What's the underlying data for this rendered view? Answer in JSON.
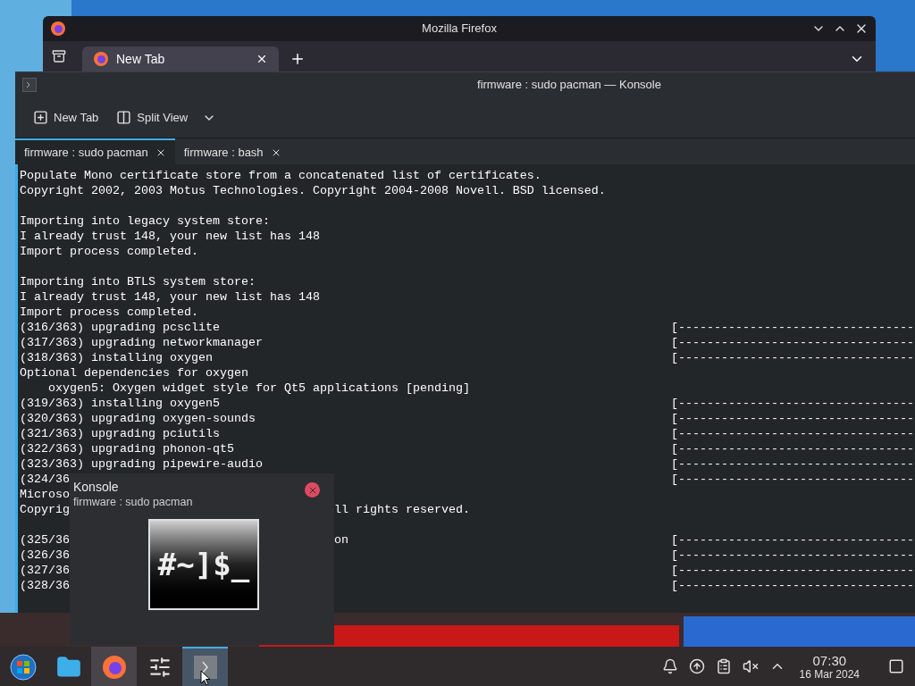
{
  "firefox": {
    "title": "Mozilla Firefox",
    "tabs": [
      {
        "label": "New Tab",
        "selected": true
      }
    ]
  },
  "konsole": {
    "title": "firmware : sudo pacman — Konsole",
    "toolbar": [
      "New Tab",
      "Split View"
    ],
    "tabs": [
      {
        "label": "firmware : sudo pacman",
        "selected": true
      },
      {
        "label": "firmware : bash",
        "selected": false
      }
    ],
    "lines": [
      {
        "kind": "text",
        "text": "Populate Mono certificate store from a concatenated list of certificates."
      },
      {
        "kind": "text",
        "text": "Copyright 2002, 2003 Motus Technologies. Copyright 2004-2008 Novell. BSD licensed."
      },
      {
        "kind": "blank"
      },
      {
        "kind": "text",
        "text": "Importing into legacy system store:"
      },
      {
        "kind": "text",
        "text": "I already trust 148, your new list has 148"
      },
      {
        "kind": "text",
        "text": "Import process completed."
      },
      {
        "kind": "blank"
      },
      {
        "kind": "text",
        "text": "Importing into BTLS system store:"
      },
      {
        "kind": "text",
        "text": "I already trust 148, your new list has 148"
      },
      {
        "kind": "text",
        "text": "Import process completed."
      },
      {
        "kind": "text",
        "text": "(316/363) upgrading pcsclite",
        "progress": "[---------------------------------"
      },
      {
        "kind": "text",
        "text": "(317/363) upgrading networkmanager",
        "progress": "[---------------------------------"
      },
      {
        "kind": "text",
        "text": "(318/363) installing oxygen",
        "progress": "[---------------------------------"
      },
      {
        "kind": "text",
        "text": "Optional dependencies for oxygen"
      },
      {
        "kind": "text",
        "text": "    oxygen5: Oxygen widget style for Qt5 applications [pending]"
      },
      {
        "kind": "text",
        "text": "(319/363) installing oxygen5",
        "progress": "[---------------------------------"
      },
      {
        "kind": "text",
        "text": "(320/363) upgrading oxygen-sounds",
        "progress": "[---------------------------------"
      },
      {
        "kind": "text",
        "text": "(321/363) upgrading pciutils",
        "progress": "[---------------------------------"
      },
      {
        "kind": "text",
        "text": "(322/363) upgrading phonon-qt5",
        "progress": "[---------------------------------"
      },
      {
        "kind": "text",
        "text": "(323/363) upgrading pipewire-audio",
        "progress": "[---------------------------------"
      },
      {
        "kind": "text",
        "text": "(324/36",
        "progress": "[---------------------------------"
      },
      {
        "kind": "text",
        "text": "Microso"
      },
      {
        "kind": "text",
        "text": "Copyrig",
        "text_right": "ll rights reserved."
      },
      {
        "kind": "blank"
      },
      {
        "kind": "text",
        "text": "(325/36",
        "text_right": "on",
        "progress": "[---------------------------------"
      },
      {
        "kind": "text",
        "text": "(326/36",
        "progress": "[---------------------------------"
      },
      {
        "kind": "text",
        "text": "(327/36",
        "progress": "[---------------------------------"
      },
      {
        "kind": "text",
        "text": "(328/36",
        "progress": "[---------------------------------"
      }
    ]
  },
  "tooltip": {
    "title": "Konsole",
    "subtitle": "firmware : sudo pacman",
    "thumbnail_text": "#~]$_"
  },
  "taskbar": {
    "items": [
      {
        "kind": "start",
        "running": false,
        "selected": false
      },
      {
        "kind": "files",
        "running": false,
        "selected": false
      },
      {
        "kind": "browser",
        "running": true,
        "selected": false
      },
      {
        "kind": "mixer",
        "running": false,
        "selected": false
      },
      {
        "kind": "terminal",
        "running": true,
        "selected": true
      }
    ],
    "clock": {
      "time": "07:30",
      "date": "16 Mar 2024"
    }
  }
}
